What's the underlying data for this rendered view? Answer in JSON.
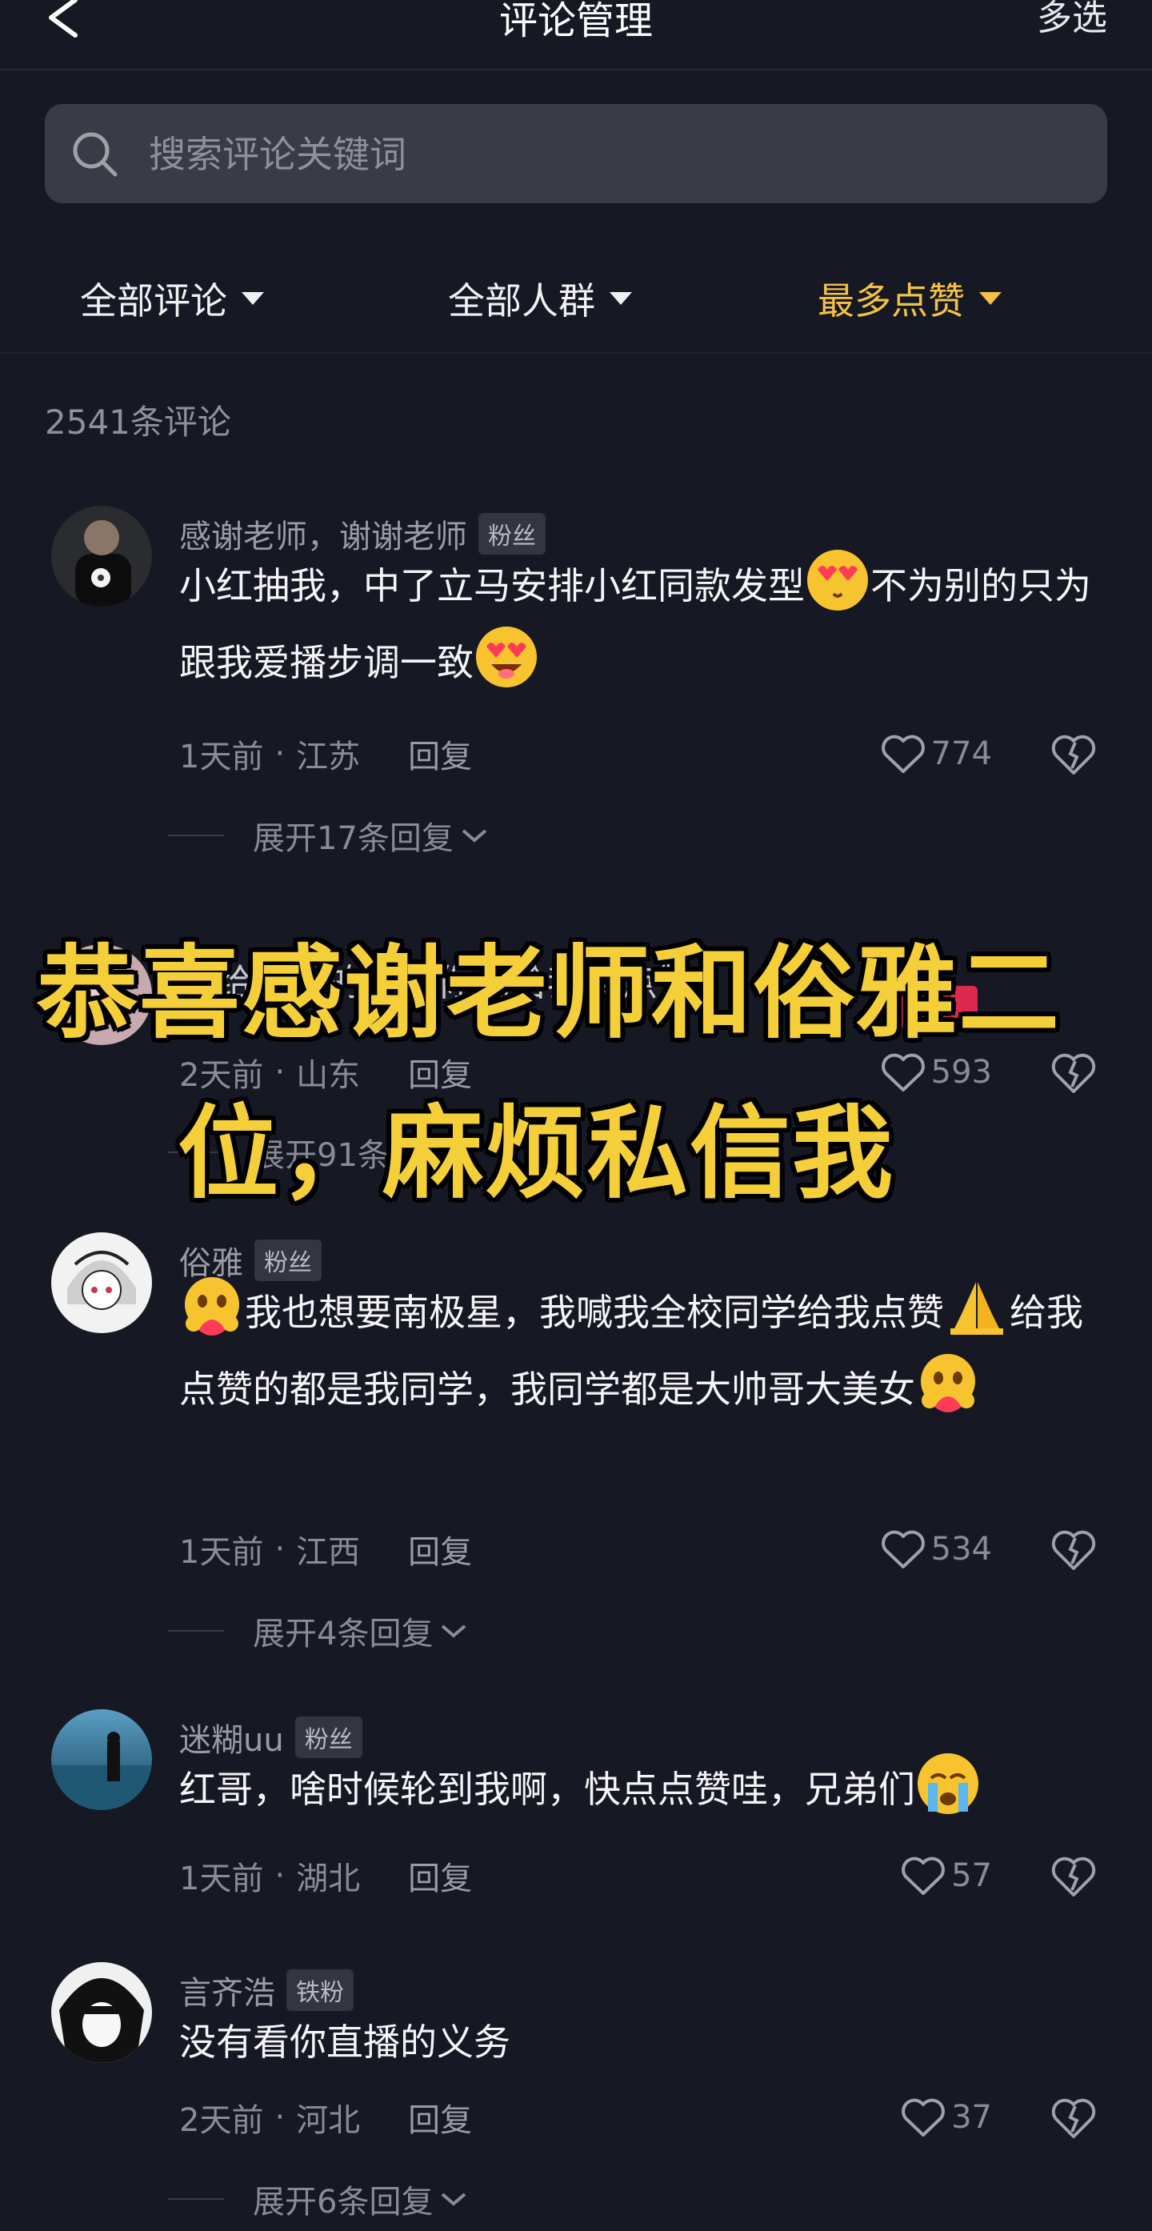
{
  "header": {
    "title": "评论管理",
    "action": "多选"
  },
  "search": {
    "placeholder": "搜索评论关键词"
  },
  "filters": [
    {
      "label": "全部评论",
      "active": false
    },
    {
      "label": "全部人群",
      "active": false
    },
    {
      "label": "最多点赞",
      "active": true
    }
  ],
  "count_label": "2541条评论",
  "comments": [
    {
      "author": "感谢老师，谢谢老师",
      "badge": "粉丝",
      "text_parts": [
        "小红抽我，中了立马安排小红同款发型",
        "不为别的只为跟我爱播步调一致"
      ],
      "emojis": [
        "heart-eyes-emoji",
        "star-struck-emoji"
      ],
      "time": "1天前",
      "location": "江苏",
      "reply": "回复",
      "likes": "774",
      "expand": "展开17条回复"
    },
    {
      "text": "拍给我看的，家你们给我点点赞！！！",
      "tag": "首评",
      "time": "2天前",
      "location": "山东",
      "reply": "回复",
      "likes": "593",
      "expand": "展开91条回复"
    },
    {
      "author": "俗雅",
      "badge": "粉丝",
      "text_parts": [
        "我也想要南极星，我喊我全校同学给我点赞",
        "给我点赞的都是我同学，我同学都是大帅哥大美女"
      ],
      "emojis": [
        "hugging-emoji",
        "folded-hands-emoji",
        "hugging-emoji"
      ],
      "time": "1天前",
      "location": "江西",
      "reply": "回复",
      "likes": "534",
      "expand": "展开4条回复"
    },
    {
      "author": "迷糊uu",
      "badge": "粉丝",
      "text": "红哥，啥时候轮到我啊，快点点赞哇，兄弟们",
      "emojis": [
        "crying-emoji"
      ],
      "time": "1天前",
      "location": "湖北",
      "reply": "回复",
      "likes": "57"
    },
    {
      "author": "言齐浩",
      "badge": "铁粉",
      "text": "没有看你直播的义务",
      "time": "2天前",
      "location": "河北",
      "reply": "回复",
      "likes": "37",
      "expand": "展开6条回复"
    }
  ],
  "overlay": {
    "line1": "恭喜感谢老师和俗雅二",
    "line2": "位，麻烦私信我"
  },
  "colors": {
    "background": "#161823",
    "accent": "#f4c243",
    "overlay_text": "#f4cf3a",
    "muted": "#8a8b94"
  }
}
